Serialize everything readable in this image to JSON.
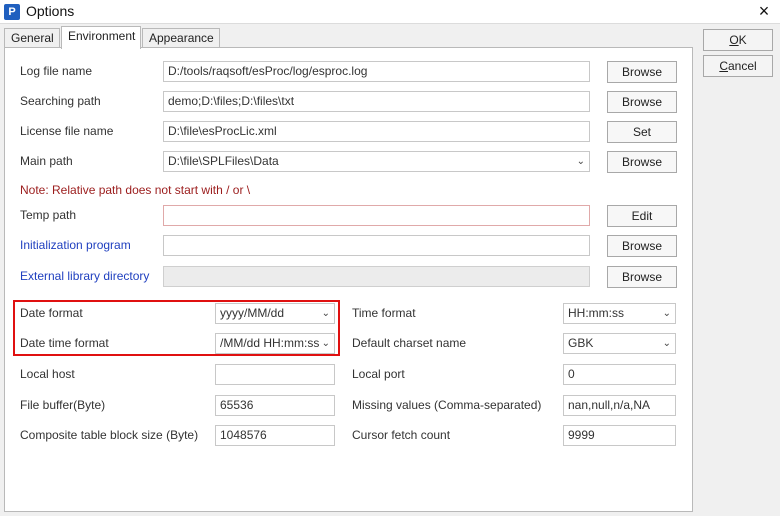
{
  "window": {
    "title": "Options",
    "app_icon": "P",
    "close": "×"
  },
  "tabs": [
    {
      "label": "General"
    },
    {
      "label": "Environment"
    },
    {
      "label": "Appearance"
    }
  ],
  "side_buttons": {
    "ok": "OK",
    "ok_ul": "O",
    "ok_rest": "K",
    "cancel": "Cancel",
    "cancel_ul": "C",
    "cancel_rest": "ancel"
  },
  "rows": {
    "log": {
      "label": "Log file name",
      "value": "D:/tools/raqsoft/esProc/log/esproc.log",
      "button": "Browse"
    },
    "search": {
      "label": "Searching path",
      "value": "demo;D:\\files;D:\\files\\txt",
      "button": "Browse"
    },
    "license": {
      "label": "License file name",
      "value": "D:\\file\\esProcLic.xml",
      "button": "Set"
    },
    "main": {
      "label": "Main path",
      "value": "D:\\file\\SPLFiles\\Data",
      "button": "Browse"
    },
    "note": "Note: Relative path does not start with / or \\",
    "temp": {
      "label": "Temp path",
      "value": "",
      "button": "Edit"
    },
    "init": {
      "label": "Initialization program",
      "value": "",
      "button": "Browse"
    },
    "extlib": {
      "label": "External library directory",
      "value": "",
      "button": "Browse"
    }
  },
  "grid": {
    "date_format": {
      "label": "Date format",
      "value": "yyyy/MM/dd"
    },
    "datetime_format": {
      "label": "Date time format",
      "value": "‎/MM/dd HH:mm:ss"
    },
    "local_host": {
      "label": "Local host",
      "value": ""
    },
    "file_buffer": {
      "label": "File buffer(Byte)",
      "value": "65536"
    },
    "block_size": {
      "label": "Composite table block size (Byte)",
      "value": "1048576"
    },
    "time_format": {
      "label": "Time format",
      "value": "HH:mm:ss"
    },
    "charset": {
      "label": "Default charset name",
      "value": "GBK"
    },
    "local_port": {
      "label": "Local port",
      "value": "0"
    },
    "missing": {
      "label": "Missing values (Comma-separated)",
      "value": "nan,null,n/a,NA"
    },
    "cursor_fetch": {
      "label": "Cursor fetch count",
      "value": "9999"
    }
  },
  "colors": {
    "highlight": "#e01010",
    "note": "#9b1c1c",
    "link_label": "#1f3fbf"
  }
}
